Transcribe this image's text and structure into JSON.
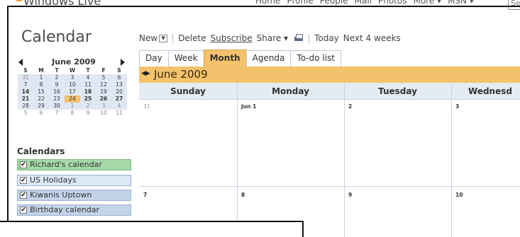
{
  "topbar": {
    "brand": "Windows Live",
    "nav": [
      "Home",
      "Profile",
      "People",
      "Mail",
      "Photos",
      "More ▾",
      "MSN ▾"
    ],
    "search_placeholder": "Se"
  },
  "app": {
    "title": "Calendar"
  },
  "toolbar": {
    "new_label": "New",
    "delete_label": "Delete",
    "subscribe_label": "Subscribe",
    "share_label": "Share ▾",
    "today_label": "Today",
    "next_label": "Next 4 weeks"
  },
  "tabs": [
    {
      "label": "Day",
      "active": false
    },
    {
      "label": "Week",
      "active": false
    },
    {
      "label": "Month",
      "active": true
    },
    {
      "label": "Agenda",
      "active": false
    },
    {
      "label": "To-do list",
      "active": false
    }
  ],
  "mini_calendar": {
    "title": "June 2009",
    "weekdays": [
      "S",
      "M",
      "T",
      "W",
      "T",
      "F",
      "S"
    ],
    "weeks": [
      [
        "31",
        "1",
        "2",
        "3",
        "4",
        "5",
        "6"
      ],
      [
        "7",
        "8",
        "9",
        "10",
        "11",
        "12",
        "13"
      ],
      [
        "14",
        "15",
        "16",
        "17",
        "18",
        "19",
        "20"
      ],
      [
        "21",
        "22",
        "23",
        "24",
        "25",
        "26",
        "27"
      ],
      [
        "28",
        "29",
        "30",
        "1",
        "2",
        "3",
        "4"
      ],
      [
        "5",
        "6",
        "7",
        "8",
        "9",
        "10",
        "11"
      ]
    ],
    "today": "24"
  },
  "calendars": {
    "title": "Calendars",
    "items": [
      {
        "label": "Richard's calendar",
        "color": "#a6d9a8",
        "checked": true
      },
      {
        "label": "US Holidays",
        "color": "#dce9f7",
        "checked": true
      },
      {
        "label": "Kiwanis Uptown",
        "color": "#c3d3ea",
        "checked": true
      },
      {
        "label": "Birthday calendar",
        "color": "#c3d3ea",
        "checked": true
      }
    ]
  },
  "month_view": {
    "title": "June 2009",
    "days": [
      "Sunday",
      "Monday",
      "Tuesday",
      "Wednesd"
    ],
    "week1": [
      "31",
      "Jun 1",
      "2",
      "3"
    ],
    "week2": [
      "7",
      "8",
      "9",
      "10"
    ]
  },
  "colors": {
    "accent": "#f4c26c",
    "header_bg": "#e5ebf3",
    "mini_bg": "#dfe7f3"
  }
}
